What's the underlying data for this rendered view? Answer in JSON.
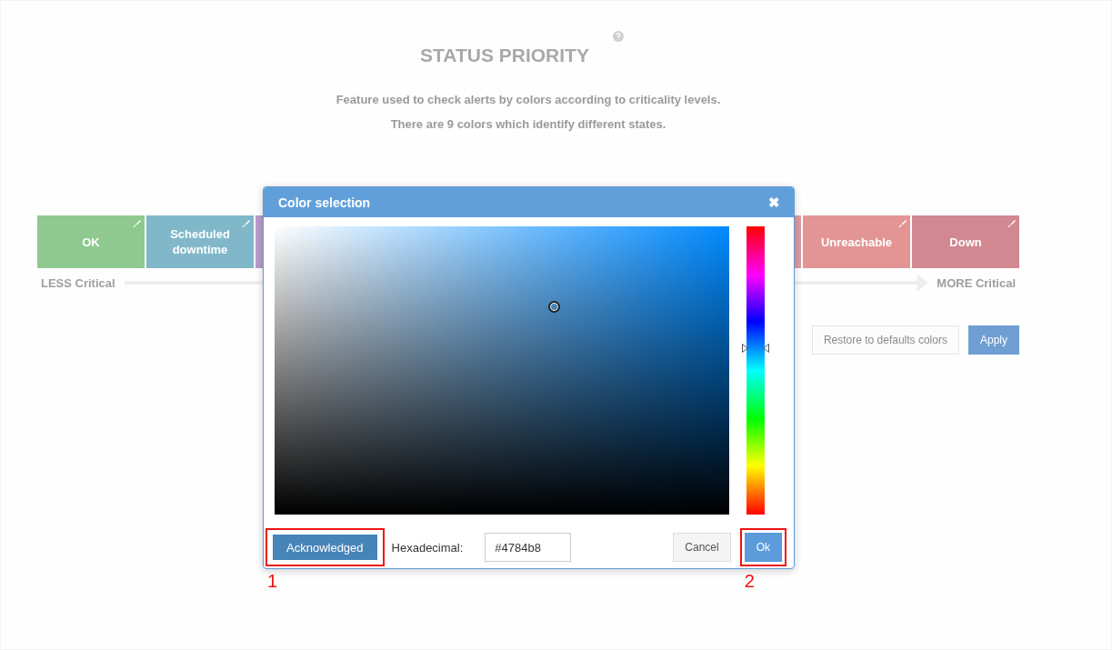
{
  "page": {
    "title": "STATUS PRIORITY",
    "description": [
      "Feature used to check alerts by colors according to criticality levels.",
      "There are 9 colors which identify different states."
    ],
    "tiles_left": [
      {
        "label": "OK",
        "color": "#8fc98f"
      },
      {
        "label": "Scheduled downtime",
        "color": "#80b8c9"
      },
      {
        "color": "#b99cc8"
      }
    ],
    "tiles_right": [
      {
        "color": "#e09aa0"
      },
      {
        "label": "Unreachable",
        "color": "#e39595"
      },
      {
        "label": "Down",
        "color": "#d18890"
      }
    ],
    "scale": {
      "start": "LESS Critical",
      "end": "MORE Critical"
    },
    "buttons": [
      {
        "label": "Restore to defaults colors",
        "kind": "default"
      },
      {
        "label": "Apply",
        "kind": "primary"
      }
    ]
  },
  "dialog": {
    "title": "Color selection",
    "close": "✖",
    "hex_value": "#4784b8",
    "state_button": "Acknowledged",
    "state_annotation": "1",
    "hex_label": "Hexadecimal:",
    "cancel": "Cancel",
    "ok": "Ok",
    "ok_annotation": "2"
  }
}
